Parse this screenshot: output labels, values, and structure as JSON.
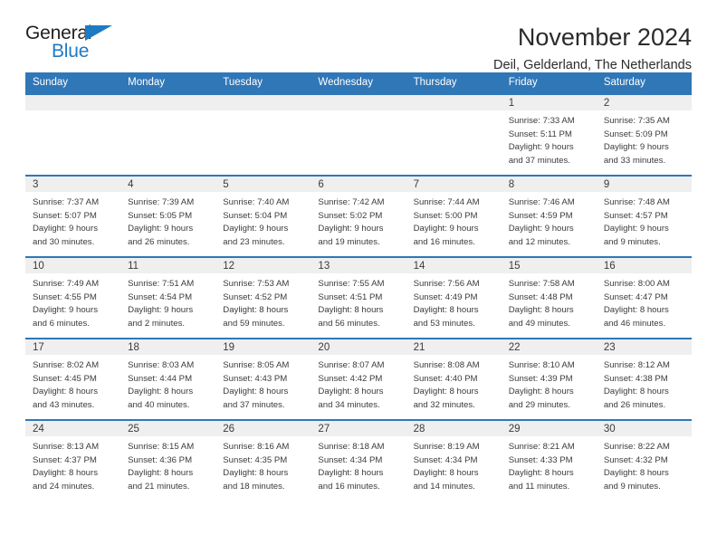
{
  "brand": {
    "name_part1": "General",
    "name_part2": "Blue"
  },
  "header": {
    "title": "November 2024",
    "subtitle": "Deil, Gelderland, The Netherlands"
  },
  "colors": {
    "header_blue": "#3077b8",
    "daynum_band": "#efefef",
    "text": "#3b3b3b",
    "brand_blue": "#1f7ac4"
  },
  "labels": {
    "sunrise_prefix": "Sunrise:",
    "sunset_prefix": "Sunset:",
    "daylight_prefix": "Daylight:"
  },
  "weekdays": [
    "Sunday",
    "Monday",
    "Tuesday",
    "Wednesday",
    "Thursday",
    "Friday",
    "Saturday"
  ],
  "weeks": [
    [
      {
        "empty": true
      },
      {
        "empty": true
      },
      {
        "empty": true
      },
      {
        "empty": true
      },
      {
        "empty": true
      },
      {
        "day": "1",
        "sunrise": "Sunrise: 7:33 AM",
        "sunset": "Sunset: 5:11 PM",
        "daylight": "Daylight: 9 hours and 37 minutes."
      },
      {
        "day": "2",
        "sunrise": "Sunrise: 7:35 AM",
        "sunset": "Sunset: 5:09 PM",
        "daylight": "Daylight: 9 hours and 33 minutes."
      }
    ],
    [
      {
        "day": "3",
        "sunrise": "Sunrise: 7:37 AM",
        "sunset": "Sunset: 5:07 PM",
        "daylight": "Daylight: 9 hours and 30 minutes."
      },
      {
        "day": "4",
        "sunrise": "Sunrise: 7:39 AM",
        "sunset": "Sunset: 5:05 PM",
        "daylight": "Daylight: 9 hours and 26 minutes."
      },
      {
        "day": "5",
        "sunrise": "Sunrise: 7:40 AM",
        "sunset": "Sunset: 5:04 PM",
        "daylight": "Daylight: 9 hours and 23 minutes."
      },
      {
        "day": "6",
        "sunrise": "Sunrise: 7:42 AM",
        "sunset": "Sunset: 5:02 PM",
        "daylight": "Daylight: 9 hours and 19 minutes."
      },
      {
        "day": "7",
        "sunrise": "Sunrise: 7:44 AM",
        "sunset": "Sunset: 5:00 PM",
        "daylight": "Daylight: 9 hours and 16 minutes."
      },
      {
        "day": "8",
        "sunrise": "Sunrise: 7:46 AM",
        "sunset": "Sunset: 4:59 PM",
        "daylight": "Daylight: 9 hours and 12 minutes."
      },
      {
        "day": "9",
        "sunrise": "Sunrise: 7:48 AM",
        "sunset": "Sunset: 4:57 PM",
        "daylight": "Daylight: 9 hours and 9 minutes."
      }
    ],
    [
      {
        "day": "10",
        "sunrise": "Sunrise: 7:49 AM",
        "sunset": "Sunset: 4:55 PM",
        "daylight": "Daylight: 9 hours and 6 minutes."
      },
      {
        "day": "11",
        "sunrise": "Sunrise: 7:51 AM",
        "sunset": "Sunset: 4:54 PM",
        "daylight": "Daylight: 9 hours and 2 minutes."
      },
      {
        "day": "12",
        "sunrise": "Sunrise: 7:53 AM",
        "sunset": "Sunset: 4:52 PM",
        "daylight": "Daylight: 8 hours and 59 minutes."
      },
      {
        "day": "13",
        "sunrise": "Sunrise: 7:55 AM",
        "sunset": "Sunset: 4:51 PM",
        "daylight": "Daylight: 8 hours and 56 minutes."
      },
      {
        "day": "14",
        "sunrise": "Sunrise: 7:56 AM",
        "sunset": "Sunset: 4:49 PM",
        "daylight": "Daylight: 8 hours and 53 minutes."
      },
      {
        "day": "15",
        "sunrise": "Sunrise: 7:58 AM",
        "sunset": "Sunset: 4:48 PM",
        "daylight": "Daylight: 8 hours and 49 minutes."
      },
      {
        "day": "16",
        "sunrise": "Sunrise: 8:00 AM",
        "sunset": "Sunset: 4:47 PM",
        "daylight": "Daylight: 8 hours and 46 minutes."
      }
    ],
    [
      {
        "day": "17",
        "sunrise": "Sunrise: 8:02 AM",
        "sunset": "Sunset: 4:45 PM",
        "daylight": "Daylight: 8 hours and 43 minutes."
      },
      {
        "day": "18",
        "sunrise": "Sunrise: 8:03 AM",
        "sunset": "Sunset: 4:44 PM",
        "daylight": "Daylight: 8 hours and 40 minutes."
      },
      {
        "day": "19",
        "sunrise": "Sunrise: 8:05 AM",
        "sunset": "Sunset: 4:43 PM",
        "daylight": "Daylight: 8 hours and 37 minutes."
      },
      {
        "day": "20",
        "sunrise": "Sunrise: 8:07 AM",
        "sunset": "Sunset: 4:42 PM",
        "daylight": "Daylight: 8 hours and 34 minutes."
      },
      {
        "day": "21",
        "sunrise": "Sunrise: 8:08 AM",
        "sunset": "Sunset: 4:40 PM",
        "daylight": "Daylight: 8 hours and 32 minutes."
      },
      {
        "day": "22",
        "sunrise": "Sunrise: 8:10 AM",
        "sunset": "Sunset: 4:39 PM",
        "daylight": "Daylight: 8 hours and 29 minutes."
      },
      {
        "day": "23",
        "sunrise": "Sunrise: 8:12 AM",
        "sunset": "Sunset: 4:38 PM",
        "daylight": "Daylight: 8 hours and 26 minutes."
      }
    ],
    [
      {
        "day": "24",
        "sunrise": "Sunrise: 8:13 AM",
        "sunset": "Sunset: 4:37 PM",
        "daylight": "Daylight: 8 hours and 24 minutes."
      },
      {
        "day": "25",
        "sunrise": "Sunrise: 8:15 AM",
        "sunset": "Sunset: 4:36 PM",
        "daylight": "Daylight: 8 hours and 21 minutes."
      },
      {
        "day": "26",
        "sunrise": "Sunrise: 8:16 AM",
        "sunset": "Sunset: 4:35 PM",
        "daylight": "Daylight: 8 hours and 18 minutes."
      },
      {
        "day": "27",
        "sunrise": "Sunrise: 8:18 AM",
        "sunset": "Sunset: 4:34 PM",
        "daylight": "Daylight: 8 hours and 16 minutes."
      },
      {
        "day": "28",
        "sunrise": "Sunrise: 8:19 AM",
        "sunset": "Sunset: 4:34 PM",
        "daylight": "Daylight: 8 hours and 14 minutes."
      },
      {
        "day": "29",
        "sunrise": "Sunrise: 8:21 AM",
        "sunset": "Sunset: 4:33 PM",
        "daylight": "Daylight: 8 hours and 11 minutes."
      },
      {
        "day": "30",
        "sunrise": "Sunrise: 8:22 AM",
        "sunset": "Sunset: 4:32 PM",
        "daylight": "Daylight: 8 hours and 9 minutes."
      }
    ]
  ]
}
